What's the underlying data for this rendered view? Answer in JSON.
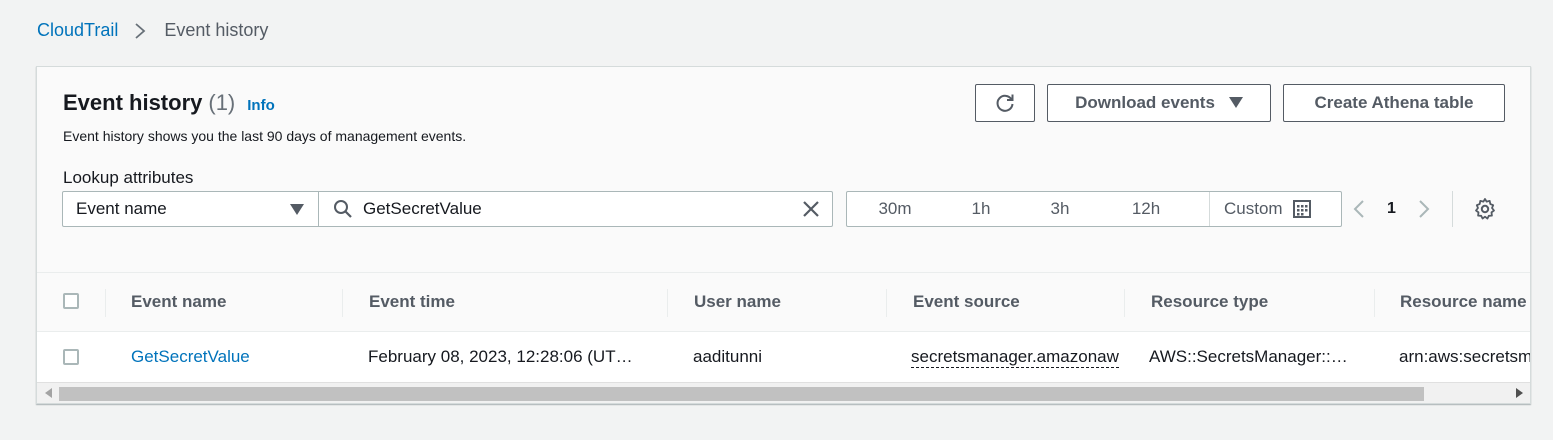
{
  "breadcrumb": {
    "root": "CloudTrail",
    "current": "Event history"
  },
  "header": {
    "title": "Event history",
    "count": "(1)",
    "info": "Info",
    "description": "Event history shows you the last 90 days of management events.",
    "download_label": "Download events",
    "athena_label": "Create Athena table"
  },
  "lookup": {
    "label": "Lookup attributes",
    "attribute": "Event name",
    "search_value": "GetSecretValue"
  },
  "time_range": {
    "options": [
      "30m",
      "1h",
      "3h",
      "12h"
    ],
    "custom_label": "Custom"
  },
  "pagination": {
    "page": "1"
  },
  "table": {
    "columns": [
      "Event name",
      "Event time",
      "User name",
      "Event source",
      "Resource type",
      "Resource name"
    ],
    "rows": [
      {
        "event_name": "GetSecretValue",
        "event_time": "February 08, 2023, 12:28:06 (UT…",
        "user_name": "aaditunni",
        "event_source": "secretsmanager.amazonaw",
        "resource_type": "AWS::SecretsManager::…",
        "resource_name": "arn:aws:secretsm"
      }
    ]
  },
  "colors": {
    "link": "#0073bb",
    "text": "#16191f",
    "muted": "#545b64",
    "border": "#aab7b8"
  }
}
